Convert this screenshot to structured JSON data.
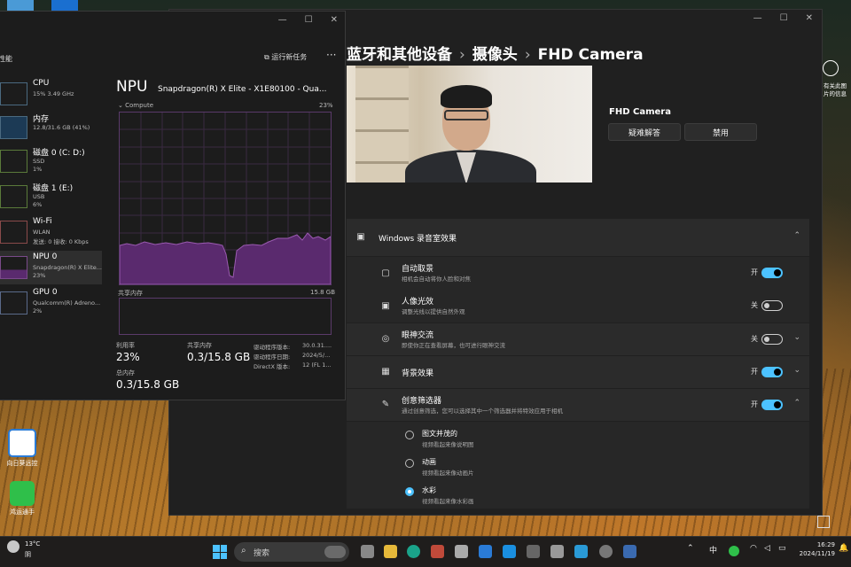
{
  "colors": {
    "accent": "#4cc2ff",
    "npu_graph": "#5a2a6e"
  },
  "desktop": {
    "icons": [
      {
        "label": "向日葵远控"
      },
      {
        "label": "鸿运通手"
      }
    ],
    "right_text": "有关此图片的信息"
  },
  "task_manager": {
    "header": "性能",
    "new_task": "运行新任务",
    "more": "···",
    "sidebar": [
      {
        "name": "CPU",
        "line2": "15% 3.49 GHz",
        "line3": ""
      },
      {
        "name": "内存",
        "line2": "12.8/31.6 GB (41%)",
        "line3": ""
      },
      {
        "name": "磁盘 0 (C: D:)",
        "line2": "SSD",
        "line3": "1%"
      },
      {
        "name": "磁盘 1 (E:)",
        "line2": "USB",
        "line3": "6%"
      },
      {
        "name": "Wi-Fi",
        "line2": "WLAN",
        "line3": "发送: 0 接收: 0 Kbps"
      },
      {
        "name": "NPU 0",
        "line2": "Snapdragon(R) X Elite...",
        "line3": "23%"
      },
      {
        "name": "GPU 0",
        "line2": "Qualcomm(R) Adreno...",
        "line3": "2%"
      }
    ],
    "npu": {
      "title": "NPU",
      "model": "Snapdragon(R) X Elite - X1E80100 - Qua...",
      "compute_label": "Compute",
      "compute_pct": "23%",
      "shared_label": "共享内存",
      "shared_max": "15.8 GB",
      "util_label": "利用率",
      "util_value": "23%",
      "shared_mem_label": "共享内存",
      "shared_mem_value": "0.3/15.8 GB",
      "total_mem_label": "总内存",
      "total_mem_value": "0.3/15.8 GB",
      "driver_version_label": "驱动程序版本:",
      "driver_version_value": "30.0.31....",
      "driver_date_label": "驱动程序日期:",
      "driver_date_value": "2024/5/...",
      "directx_label": "DirectX 版本:",
      "directx_value": "12 (FL 1..."
    }
  },
  "settings": {
    "breadcrumb": [
      "蓝牙和其他设备",
      "摄像头",
      "FHD Camera"
    ],
    "camera_name": "FHD Camera",
    "troubleshoot": "疑难解答",
    "disable": "禁用",
    "studio_effects": "Windows 录音室效果",
    "rows": [
      {
        "title": "自动取景",
        "sub": "相机会自动将你人脸和对焦",
        "state": "开",
        "on": true
      },
      {
        "title": "人像光效",
        "sub": "调整光线以提供自然外观",
        "state": "关",
        "on": false
      },
      {
        "title": "眼神交流",
        "sub": "即使你正在查看屏幕，也可进行眼神交流",
        "state": "关",
        "on": false
      },
      {
        "title": "背景效果",
        "sub": "",
        "state": "开",
        "on": true
      },
      {
        "title": "创意筛选器",
        "sub": "通过创意筛选，您可以选择其中一个筛选器并将特效应用于相机",
        "state": "开",
        "on": true
      }
    ],
    "filters": [
      {
        "label": "图文并茂的",
        "desc": "视频看起来像说明图",
        "selected": false
      },
      {
        "label": "动画",
        "desc": "视频看起来像动画片",
        "selected": false
      },
      {
        "label": "水彩",
        "desc": "视频看起来像水彩画",
        "selected": true
      }
    ]
  },
  "taskbar": {
    "weather_temp": "13°C",
    "weather_cond": "阴",
    "search": "搜索",
    "ime": "中",
    "time": "16:29",
    "date": "2024/11/19"
  }
}
